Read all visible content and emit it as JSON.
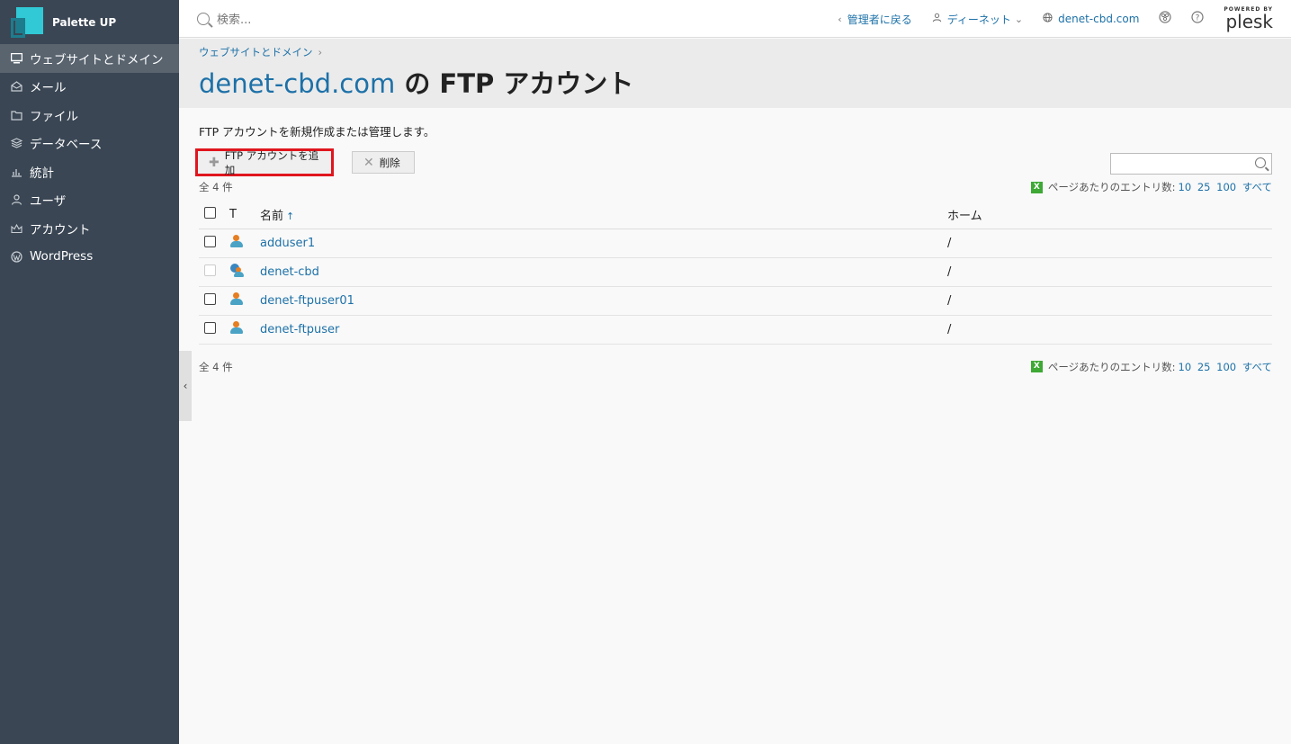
{
  "brand": {
    "name": "Palette UP"
  },
  "sidebar": {
    "items": [
      {
        "label": "ウェブサイトとドメイン",
        "icon": "monitor-icon"
      },
      {
        "label": "メール",
        "icon": "mail-icon"
      },
      {
        "label": "ファイル",
        "icon": "folder-icon"
      },
      {
        "label": "データベース",
        "icon": "database-icon"
      },
      {
        "label": "統計",
        "icon": "bar-chart-icon"
      },
      {
        "label": "ユーザ",
        "icon": "user-icon"
      },
      {
        "label": "アカウント",
        "icon": "crown-icon"
      },
      {
        "label": "WordPress",
        "icon": "wordpress-icon"
      }
    ]
  },
  "topbar": {
    "search_placeholder": "検索...",
    "back_admin": "管理者に戻る",
    "user": "ディーネット",
    "domain": "denet-cbd.com",
    "powered_by": "POWERED BY",
    "plesk": "plesk"
  },
  "header": {
    "breadcrumb": "ウェブサイトとドメイン",
    "title_domain": "denet-cbd.com",
    "title_rest": " の FTP アカウント"
  },
  "main": {
    "description": "FTP アカウントを新規作成または管理します。",
    "add_button": "FTP アカウントを追加",
    "delete_button": "削除",
    "total": "全 4 件",
    "per_page_label": "ページあたりのエントリ数:",
    "per_page_options": [
      "10",
      "25",
      "100",
      "すべて"
    ],
    "columns": {
      "t": "T",
      "name": "名前",
      "home": "ホーム"
    },
    "rows": [
      {
        "name": "adduser1",
        "home": "/",
        "type": "user"
      },
      {
        "name": "denet-cbd",
        "home": "/",
        "type": "main"
      },
      {
        "name": "denet-ftpuser01",
        "home": "/",
        "type": "user"
      },
      {
        "name": "denet-ftpuser",
        "home": "/",
        "type": "user"
      }
    ]
  },
  "colors": {
    "sidebar": "#3a4654",
    "accent": "#1d71a8",
    "highlight": "#e0161e"
  }
}
